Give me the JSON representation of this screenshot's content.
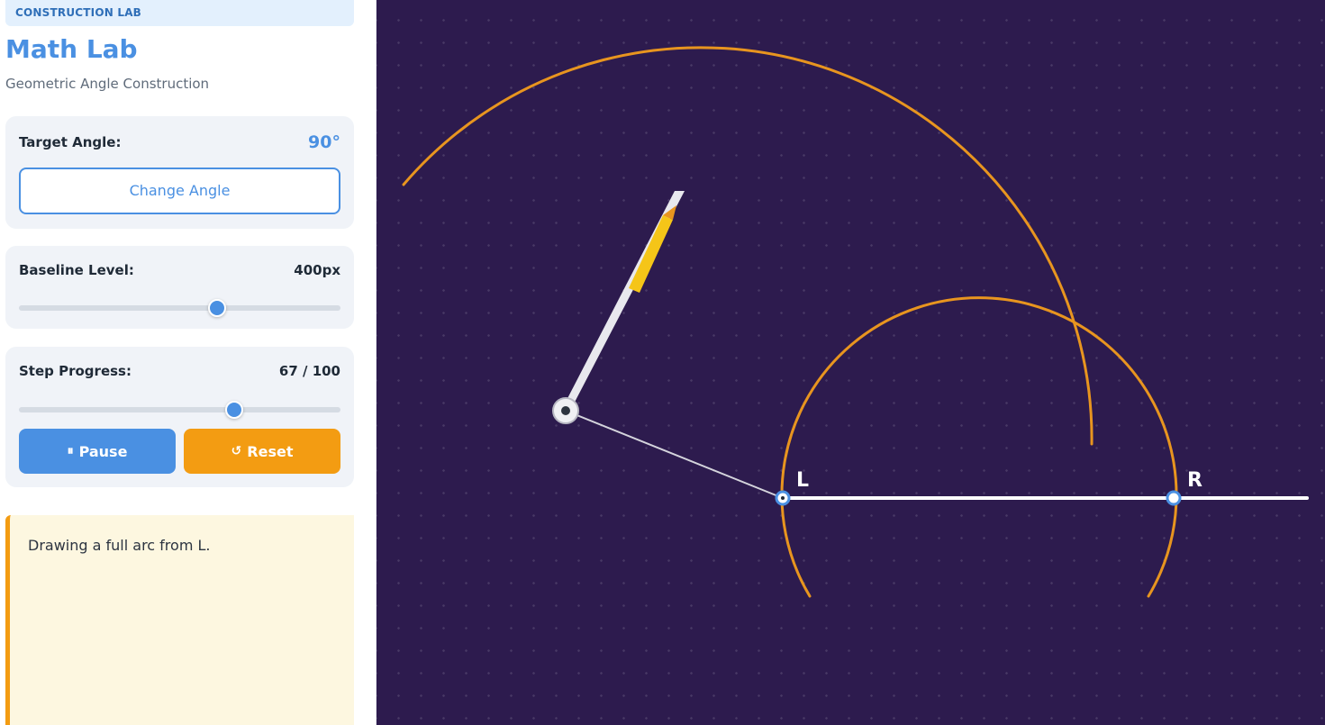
{
  "sidebar": {
    "badge": "CONSTRUCTION LAB",
    "title": "Math Lab",
    "subtitle": "Geometric Angle Construction",
    "target_angle": {
      "label": "Target Angle:",
      "value": "90°",
      "button_label": "Change Angle"
    },
    "baseline": {
      "label": "Baseline Level:",
      "value": "400px",
      "slider_fraction": 0.615
    },
    "progress": {
      "label": "Step Progress:",
      "value": "67 / 100",
      "slider_fraction": 0.67
    },
    "buttons": {
      "pause_icon": "⏸",
      "pause_label": "Pause",
      "reset_icon": "↺",
      "reset_label": "Reset"
    },
    "message": "Drawing a full arc from L."
  },
  "canvas": {
    "point_labels": {
      "left": "L",
      "right": "R"
    },
    "colors": {
      "background": "#2d1b4e",
      "arc": "#e8951f",
      "baseline": "#ffffff",
      "point_ring": "#4a90e2",
      "pencil": "#f5c518"
    }
  },
  "colors": {
    "accent": "#4a90e2",
    "warning": "#f39c12"
  }
}
